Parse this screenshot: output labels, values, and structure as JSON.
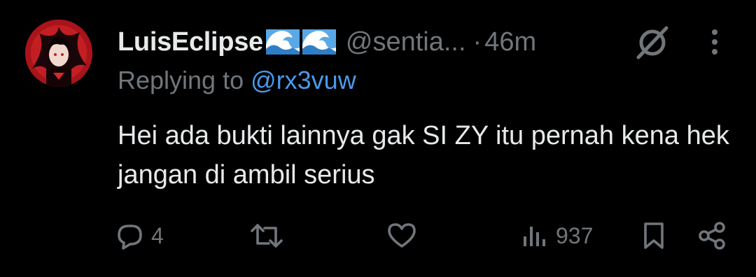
{
  "tweet": {
    "display_name": "LuisEclipse",
    "handle": "@sentia...",
    "separator": "·",
    "time": "46m",
    "replying_prefix": "Replying to",
    "replying_to": "@rx3vuw",
    "text": "Hei ada bukti lainnya gak SI ZY itu pernah kena hek jangan di ambil serius",
    "name_emojis": [
      "water-wave-icon",
      "water-wave-icon"
    ]
  },
  "actions": {
    "reply_count": "4",
    "retweet_count": "",
    "like_count": "",
    "view_count": "937"
  },
  "icons": [
    "grok-icon",
    "more-icon",
    "reply-icon",
    "retweet-icon",
    "like-icon",
    "views-icon",
    "bookmark-icon",
    "share-icon"
  ],
  "colors": {
    "background": "#000000",
    "primary_text": "#e7e9ea",
    "secondary_text": "#71767b",
    "link": "#4a99e9",
    "avatar_accent": "#b3161c"
  }
}
